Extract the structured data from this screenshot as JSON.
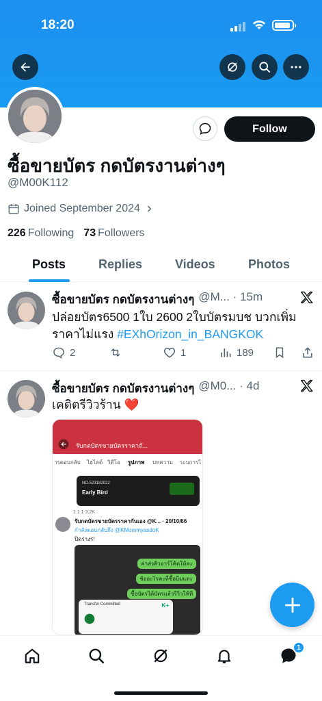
{
  "status_bar": {
    "time": "18:20"
  },
  "header": {
    "back_icon": "arrow-left-icon",
    "grok_icon": "grok-icon",
    "search_icon": "search-icon",
    "more_icon": "more-dots-icon",
    "banner_color": "#1d8ff0"
  },
  "profile": {
    "display_name": "ซื้อขายบัตร กดบัตรงานต่างๆ",
    "handle": "@M00K112",
    "joined": "Joined September 2024",
    "following_count": "226",
    "following_label": "Following",
    "followers_count": "73",
    "followers_label": "Followers",
    "follow_label": "Follow"
  },
  "tabs": [
    {
      "label": "Posts",
      "active": true
    },
    {
      "label": "Replies",
      "active": false
    },
    {
      "label": "Videos",
      "active": false
    },
    {
      "label": "Photos",
      "active": false
    }
  ],
  "posts": [
    {
      "name": "ซื้อขายบัตร กดบัตรงานต่างๆ",
      "handle_time": "@M... · 15m",
      "text": "ปล่อยบัตร6500 1ใบ 2600 2ใบบัตรมบช บวกเพิ่มราคาไม่แรง",
      "hashtag": "#EXhOrizon_in_BANGKOK",
      "replies": "2",
      "reposts": "",
      "likes": "1",
      "views": "189"
    },
    {
      "name": "ซื้อขายบัตร กดบัตรงานต่างๆ",
      "handle_time": "@M0... · 4d",
      "text": "เคดิตรีวิวร้าน ❤️",
      "embed": {
        "header_title": "รับกดบัตรขายบัตรราคาถั...",
        "tabs": [
          "ารตอบกลับ",
          "ไฮไลต์",
          "วิดีโอ",
          "รูปภาพ",
          "บทความ",
          "ระบการไ"
        ],
        "card_line1": "NO.523182022",
        "card_line2": "Early Bird",
        "stats": "1    1    1    3.2K",
        "reply_name": "รับกดบัตรขายบัตรราคากันเอง @K... · 20/10/66",
        "reply_to": "กำลังตอบกลับถึง @KMommyasdoK",
        "reply_text": "ปิดร่างร!",
        "bubbles": [
          "ค่าส่งคิวอาร์โค้ดให้คะ",
          "ช้ออะไรคะที่ซื้อบิมแดะ",
          "ซื้อบัตรได้บัตรแล้วรีวิวให้ที"
        ],
        "transfer_title": "Transfer Committed",
        "transfer_brand": "K+"
      }
    }
  ],
  "bottom_nav": {
    "items": [
      "home-icon",
      "search-icon",
      "grok-icon",
      "notifications-icon",
      "messages-icon"
    ],
    "messages_badge": "1"
  },
  "colors": {
    "accent": "#1d9bf0",
    "text": "#0f1419",
    "secondary": "#536471"
  }
}
